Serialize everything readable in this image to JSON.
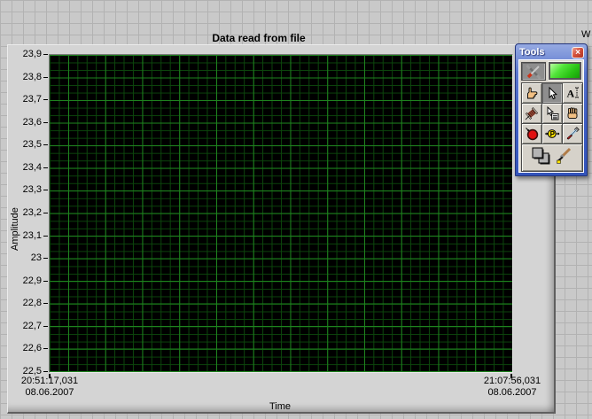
{
  "panel": {
    "chart_title": "Data read from file",
    "clipped_text_right_edge": "W"
  },
  "chart": {
    "y_axis_label": "Amplitude",
    "x_axis_label": "Time",
    "y_ticks": [
      "23,9",
      "23,8",
      "23,7",
      "23,6",
      "23,5",
      "23,4",
      "23,3",
      "23,2",
      "23,1",
      "23",
      "22,9",
      "22,8",
      "22,7",
      "22,6",
      "22,5"
    ],
    "x_start": {
      "time": "20:51:17,031",
      "date": "08.06.2007"
    },
    "x_end": {
      "time": "21:07:56,031",
      "date": "08.06.2007"
    },
    "colors": {
      "plot_background": "#000000",
      "grid_major": "#1e821e",
      "grid_minor": "#0c460c",
      "chart_body": "#d4d4d4",
      "panel_grid_cell": "#c9c9c9",
      "panel_grid_line": "#b2b2b2"
    }
  },
  "chart_data": {
    "type": "line",
    "title": "Data read from file",
    "xlabel": "Time",
    "ylabel": "Amplitude",
    "ylim": [
      22.5,
      23.9
    ],
    "y_tick_step": 0.1,
    "y_tick_values": [
      23.9,
      23.8,
      23.7,
      23.6,
      23.5,
      23.4,
      23.3,
      23.2,
      23.1,
      23.0,
      22.9,
      22.8,
      22.7,
      22.6,
      22.5
    ],
    "x_range": [
      "20:51:17,031 08.06.2007",
      "21:07:56,031 08.06.2007"
    ],
    "series": [],
    "grid": "on",
    "note": "empty waveform chart - black plot area with green major/minor grid, no visible data trace"
  },
  "tools_palette": {
    "title": "Tools",
    "close_glyph": "×",
    "led_on": true,
    "led_color": "#35d622",
    "titlebar_color": "#3e5ec4",
    "selected_tool": "position-select",
    "tools": [
      {
        "name": "auto-tool-select",
        "state": "pressed"
      },
      {
        "name": "operate-value"
      },
      {
        "name": "position-select",
        "state": "pressed"
      },
      {
        "name": "edit-text"
      },
      {
        "name": "connect-wire"
      },
      {
        "name": "object-shortcut-menu"
      },
      {
        "name": "scroll-window"
      },
      {
        "name": "set-breakpoint"
      },
      {
        "name": "probe-data"
      },
      {
        "name": "get-color"
      },
      {
        "name": "set-color"
      }
    ]
  }
}
